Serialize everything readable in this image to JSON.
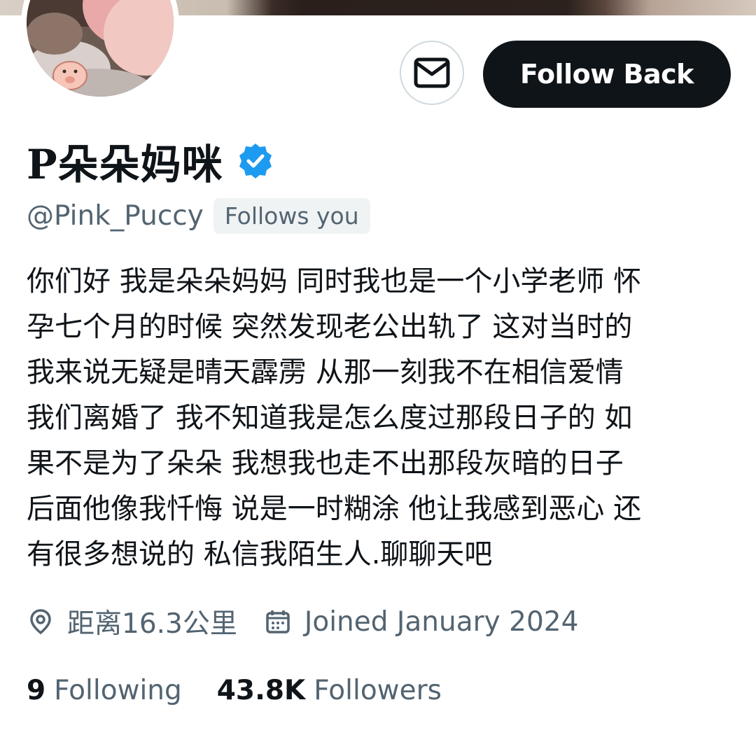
{
  "profile": {
    "display_name": "P朵朵妈咪",
    "handle": "@Pink_Puccy",
    "follows_you": "Follows you",
    "bio": "你们好 我是朵朵妈妈 同时我也是一个小学老师 怀\n孕七个月的时候 突然发现老公出轨了 这对当时的\n我来说无疑是晴天霹雳 从那一刻我不在相信爱情\n我们离婚了 我不知道我是怎么度过那段日子的 如\n果不是为了朵朵 我想我也走不出那段灰暗的日子\n后面他像我忏悔 说是一时糊涂 他让我感到恶心 还\n有很多想说的 私信我陌生人.聊聊天吧",
    "location": "距离16.3公里",
    "joined": "Joined January 2024",
    "verified": true
  },
  "actions": {
    "follow_label": "Follow Back",
    "message_icon": "envelope-icon"
  },
  "stats": {
    "following_count": "9",
    "following_label": "Following",
    "followers_count": "43.8K",
    "followers_label": "Followers"
  },
  "icons": {
    "location": "location-pin-icon",
    "calendar": "calendar-icon",
    "verified": "verified-badge-icon"
  },
  "colors": {
    "text_primary": "#0f1419",
    "text_secondary": "#536471",
    "verified_blue": "#1d9bf0",
    "button_dark": "#0f1419",
    "pill_bg": "#eff3f4"
  }
}
